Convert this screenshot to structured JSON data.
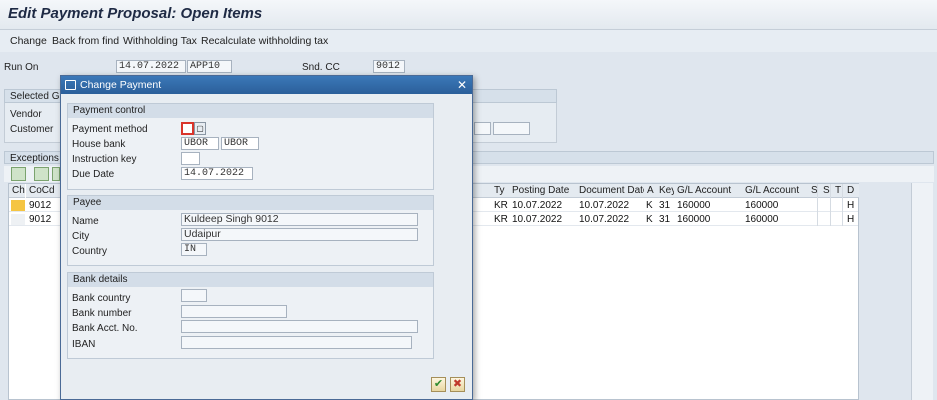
{
  "window": {
    "title": "Edit Payment Proposal: Open Items"
  },
  "menu": [
    "Change",
    "Back from find",
    "Withholding Tax",
    "Recalculate withholding tax"
  ],
  "header": {
    "run_on_label": "Run On",
    "run_on_date": "14.07.2022",
    "run_on_id": "APP10",
    "snd_cc_label": "Snd. CC",
    "snd_cc_value": "9012"
  },
  "selected_group": {
    "label": "Selected Gro",
    "vendor_label": "Vendor",
    "customer_label": "Customer"
  },
  "exceptions": {
    "label": "Exceptions"
  },
  "grid": {
    "columns_left": [
      "Ch",
      "CoCd"
    ],
    "columns_right": [
      "Ty",
      "Posting Date",
      "Document Date",
      "A",
      "Key",
      "G/L Account",
      "G/L Account",
      "S",
      "S",
      "T",
      "D"
    ],
    "rows": [
      {
        "cocd": "9012",
        "ty": "KR",
        "posting": "10.07.2022",
        "docdate": "10.07.2022",
        "a": "K",
        "key": "31",
        "gl1": "160000",
        "gl2": "160000",
        "d": "H"
      },
      {
        "cocd": "9012",
        "ty": "KR",
        "posting": "10.07.2022",
        "docdate": "10.07.2022",
        "a": "K",
        "key": "31",
        "gl1": "160000",
        "gl2": "160000",
        "d": "H"
      }
    ]
  },
  "dialog": {
    "title": "Change Payment",
    "payment_control": {
      "header": "Payment control",
      "method_label": "Payment method",
      "method_value": "",
      "house_bank_label": "House bank",
      "house_bank_1": "UBOR",
      "house_bank_2": "UBOR",
      "instruction_label": "Instruction key",
      "instruction_value": "",
      "due_date_label": "Due Date",
      "due_date_value": "14.07.2022"
    },
    "payee": {
      "header": "Payee",
      "name_label": "Name",
      "name_value": "Kuldeep Singh 9012",
      "city_label": "City",
      "city_value": "Udaipur",
      "country_label": "Country",
      "country_value": "IN"
    },
    "bank_details": {
      "header": "Bank details",
      "country_label": "Bank country",
      "country_value": "",
      "number_label": "Bank number",
      "number_value": "",
      "acct_label": "Bank Acct. No.",
      "acct_value": "",
      "iban_label": "IBAN",
      "iban_value": ""
    }
  },
  "colors": {
    "dialog_title": "#2b5f9a",
    "ok": "#2e8b2e",
    "cancel": "#c0392b",
    "highlight": "#f5c542"
  }
}
